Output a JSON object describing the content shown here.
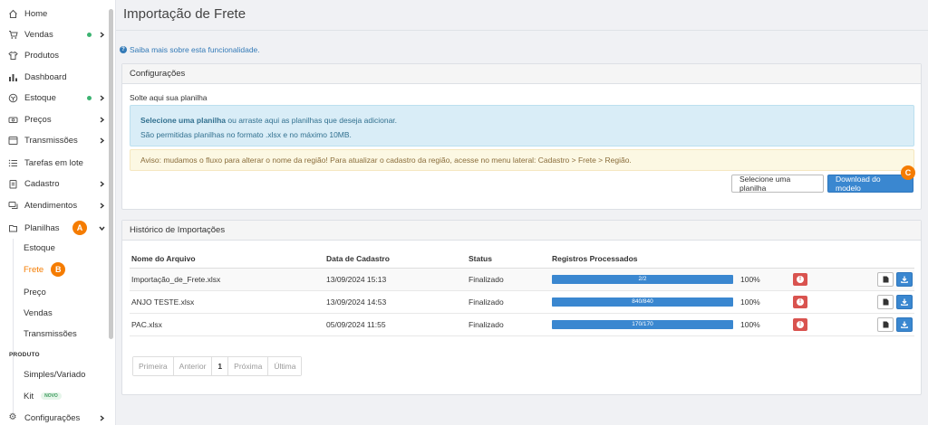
{
  "sidebar": {
    "items": [
      {
        "label": "Home",
        "icon": "home-icon",
        "dot": false,
        "chevron": "none"
      },
      {
        "label": "Vendas",
        "icon": "cart-icon",
        "dot": true,
        "chevron": "right"
      },
      {
        "label": "Produtos",
        "icon": "shirt-icon",
        "dot": false,
        "chevron": "none"
      },
      {
        "label": "Dashboard",
        "icon": "bar-chart-icon",
        "dot": false,
        "chevron": "none"
      },
      {
        "label": "Estoque",
        "icon": "box-icon",
        "dot": true,
        "chevron": "right"
      },
      {
        "label": "Preços",
        "icon": "money-icon",
        "dot": false,
        "chevron": "right"
      },
      {
        "label": "Transmissões",
        "icon": "window-icon",
        "dot": false,
        "chevron": "right"
      },
      {
        "label": "Tarefas em lote",
        "icon": "list-icon",
        "dot": false,
        "chevron": "none"
      },
      {
        "label": "Cadastro",
        "icon": "clipboard-icon",
        "dot": false,
        "chevron": "right"
      },
      {
        "label": "Atendimentos",
        "icon": "chat-icon",
        "dot": false,
        "chevron": "right"
      },
      {
        "label": "Planilhas",
        "icon": "spreadsheet-icon",
        "dot": false,
        "chevron": "down"
      }
    ],
    "subitems": [
      "Estoque",
      "Frete",
      "Preço",
      "Vendas",
      "Transmissões"
    ],
    "section_label": "PRODUTO",
    "product_items": [
      "Simples/Variado",
      "Kit"
    ],
    "kit_badge": "NOVO",
    "last_item": {
      "label": "Configurações",
      "icon": "gear-icon"
    },
    "active_color": "#f57c00",
    "markers": {
      "a": "A",
      "b": "B",
      "c": "C"
    }
  },
  "main": {
    "title": "Importação de Frete",
    "info_link": "Saiba mais sobre esta funcionalidade.",
    "config": {
      "header": "Configurações",
      "drop_label": "Solte aqui sua planilha",
      "drop_bold": "Selecione uma planilha",
      "drop_rest": " ou arraste aqui as planilhas que deseja adicionar.",
      "drop_line2": "São permitidas planilhas no formato .xlsx e no máximo 10MB.",
      "warning": "Aviso: mudamos o fluxo para alterar o nome da região! Para atualizar o cadastro da região, acesse no menu lateral: Cadastro > Frete > Região.",
      "select_button": "Selecione uma planilha",
      "download_button": "Download do modelo"
    },
    "history": {
      "header": "Histórico de Importações",
      "columns": [
        "Nome do Arquivo",
        "Data de Cadastro",
        "Status",
        "Registros Processados"
      ],
      "rows": [
        {
          "file": "Importação_de_Frete.xlsx",
          "date": "13/09/2024 15:13",
          "status": "Finalizado",
          "progress_label": "2/2",
          "percent": "100%",
          "fraction": 1.0
        },
        {
          "file": "ANJO TESTE.xlsx",
          "date": "13/09/2024 14:53",
          "status": "Finalizado",
          "progress_label": "840/840",
          "percent": "100%",
          "fraction": 1.0
        },
        {
          "file": "PAC.xlsx",
          "date": "05/09/2024 11:55",
          "status": "Finalizado",
          "progress_label": "170/170",
          "percent": "100%",
          "fraction": 1.0
        }
      ],
      "pagination": {
        "first": "Primeira",
        "prev": "Anterior",
        "current": "1",
        "next": "Próxima",
        "last": "Última"
      }
    }
  }
}
